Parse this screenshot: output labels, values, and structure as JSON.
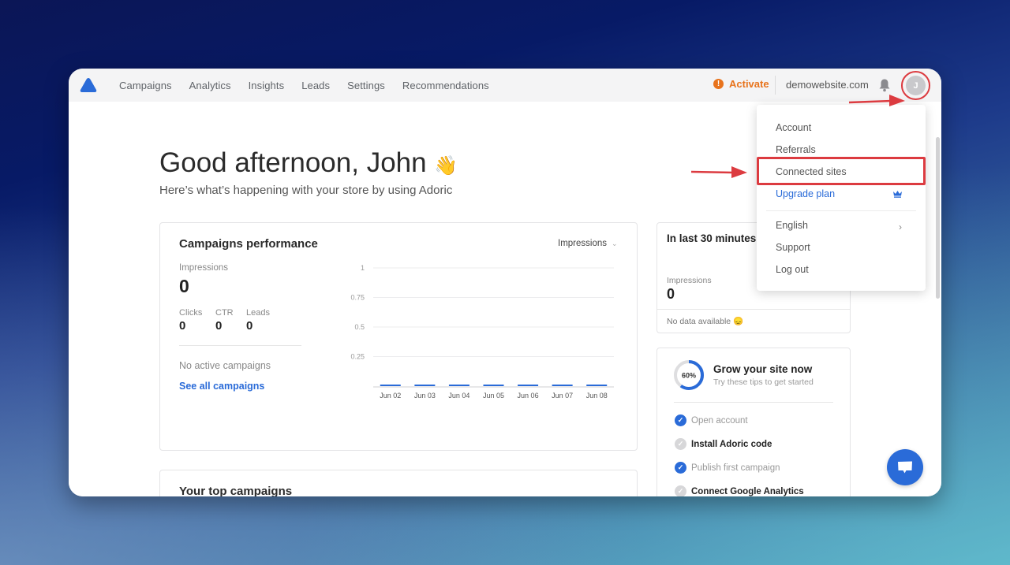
{
  "nav": {
    "items": [
      {
        "label": "Campaigns"
      },
      {
        "label": "Analytics"
      },
      {
        "label": "Insights"
      },
      {
        "label": "Leads"
      },
      {
        "label": "Settings"
      },
      {
        "label": "Recommendations"
      }
    ],
    "activate_label": "Activate",
    "activate_icon": "!",
    "site": "demowebsite.com",
    "avatar_initial": "J",
    "accent": "#2a6bd8",
    "warning_color": "#e8731c"
  },
  "header": {
    "greeting": "Good afternoon, John",
    "greeting_emoji": "👋",
    "subtitle": "Here’s what’s happening with your store by using Adoric"
  },
  "performance": {
    "title": "Campaigns performance",
    "metric_select": "Impressions",
    "impressions_label": "Impressions",
    "impressions_value": "0",
    "clicks_label": "Clicks",
    "clicks_value": "0",
    "ctr_label": "CTR",
    "ctr_value": "0",
    "leads_label": "Leads",
    "leads_value": "0",
    "no_active": "No active campaigns",
    "see_all": "See all campaigns"
  },
  "chart_data": {
    "type": "bar",
    "title": "",
    "xlabel": "",
    "ylabel": "",
    "categories": [
      "Jun 02",
      "Jun 03",
      "Jun 04",
      "Jun 05",
      "Jun 06",
      "Jun 07",
      "Jun 08"
    ],
    "values": [
      0,
      0,
      0,
      0,
      0,
      0,
      0
    ],
    "yticks": [
      "1",
      "0.75",
      "0.5",
      "0.25"
    ],
    "ylim": [
      0,
      1
    ],
    "grid": true,
    "series_color": "#2a6bd8"
  },
  "top_campaigns": {
    "title": "Your top campaigns"
  },
  "last30": {
    "title": "In last 30 minutes",
    "impressions_label": "Impressions",
    "impressions_value": "0",
    "no_data": "No data available 😞"
  },
  "grow": {
    "progress_label": "60%",
    "progress": 0.6,
    "title": "Grow your site now",
    "subtitle": "Try these tips to get started",
    "tasks": [
      {
        "label": "Open account",
        "done": true
      },
      {
        "label": "Install Adoric code",
        "done": false
      },
      {
        "label": "Publish first campaign",
        "done": true
      },
      {
        "label": "Connect Google Analytics",
        "done": false
      }
    ]
  },
  "dropdown": {
    "items": [
      {
        "label": "Account"
      },
      {
        "label": "Referrals"
      },
      {
        "label": "Connected sites"
      },
      {
        "label": "Upgrade plan"
      },
      {
        "label": "English"
      },
      {
        "label": "Support"
      },
      {
        "label": "Log out"
      }
    ]
  },
  "annotation": {
    "highlight_color": "#dc3b40"
  }
}
